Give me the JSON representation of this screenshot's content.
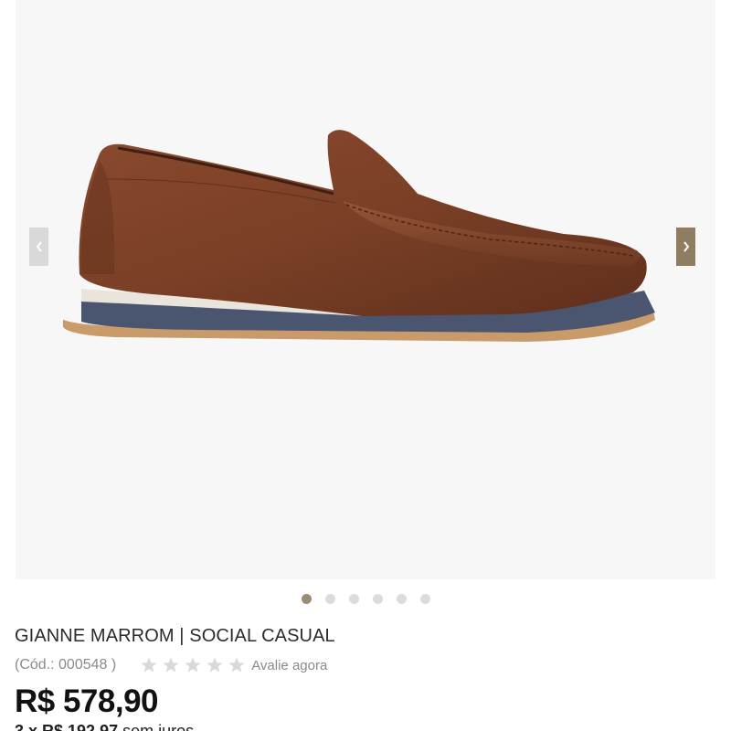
{
  "product": {
    "title": "GIANNE MARROM | SOCIAL CASUAL",
    "code": "(Cód.: 000548 )",
    "rating_stars": 5,
    "rating_value": 0,
    "rate_link": "Avalie agora",
    "price": "R$ 578,90",
    "installment_prefix": "3 x R$ 192,97",
    "installment_suffix": "sem juros"
  },
  "gallery": {
    "slide_count": 6,
    "active_slide": 1,
    "image_icon": "brown-leather-loafer-image",
    "prev_icon": "chevron-left-icon",
    "next_icon": "chevron-right-icon"
  },
  "colors": {
    "accent": "#8f7d62",
    "dot_active": "#9c8b75",
    "star_empty": "#d9d9d9"
  }
}
